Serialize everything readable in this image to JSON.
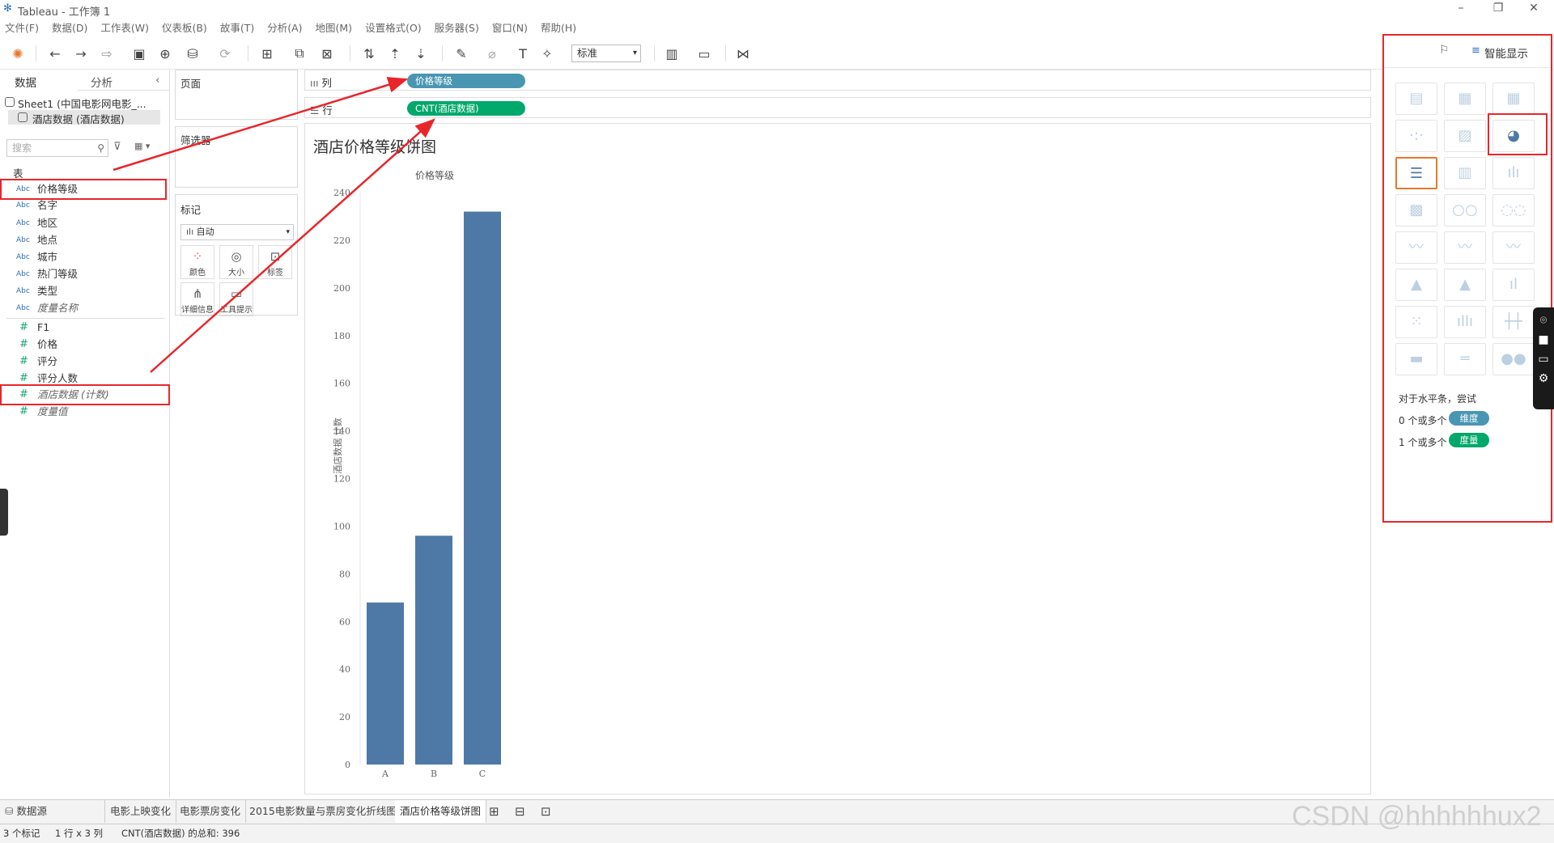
{
  "window": {
    "title": "Tableau - 工作簿 1"
  },
  "menu": [
    "文件(F)",
    "数据(D)",
    "工作表(W)",
    "仪表板(B)",
    "故事(T)",
    "分析(A)",
    "地图(M)",
    "设置格式(O)",
    "服务器(S)",
    "窗口(N)",
    "帮助(H)"
  ],
  "toolbar": {
    "fit_select": "标准"
  },
  "data_panel": {
    "tab_data": "数据",
    "tab_analysis": "分析",
    "sources": [
      "Sheet1 (中国电影网电影_...",
      "酒店数据 (酒店数据)"
    ],
    "search_placeholder": "搜索",
    "section_label": "表",
    "dimensions": [
      {
        "type": "Abc",
        "name": "价格等级"
      },
      {
        "type": "Abc",
        "name": "名字"
      },
      {
        "type": "Abc",
        "name": "地区"
      },
      {
        "type": "Abc",
        "name": "地点"
      },
      {
        "type": "Abc",
        "name": "城市"
      },
      {
        "type": "Abc",
        "name": "热门等级"
      },
      {
        "type": "Abc",
        "name": "类型"
      },
      {
        "type": "Abc",
        "name": "度量名称"
      }
    ],
    "measures": [
      {
        "type": "#",
        "name": "F1"
      },
      {
        "type": "#",
        "name": "价格"
      },
      {
        "type": "#",
        "name": "评分"
      },
      {
        "type": "#",
        "name": "评分人数"
      },
      {
        "type": "#",
        "name": "酒店数据 (计数)"
      },
      {
        "type": "#",
        "name": "度量值"
      }
    ]
  },
  "cards": {
    "pages": "页面",
    "filters": "筛选器",
    "marks": "标记",
    "mark_type": "自动",
    "mark_buttons": [
      "颜色",
      "大小",
      "标签",
      "详细信息",
      "工具提示"
    ]
  },
  "shelves": {
    "columns_label": "列",
    "rows_label": "行",
    "columns_pill": "价格等级",
    "rows_pill": "CNT(酒店数据)"
  },
  "view": {
    "title": "酒店价格等级饼图",
    "x_header": "价格等级",
    "y_label": "酒店数据 计数"
  },
  "chart_data": {
    "type": "bar",
    "categories": [
      "A",
      "B",
      "C"
    ],
    "values": [
      68,
      96,
      232
    ],
    "ylabel": "酒店数据 计数",
    "ylim": [
      0,
      240
    ],
    "yticks": [
      0,
      20,
      40,
      60,
      80,
      100,
      120,
      140,
      160,
      180,
      200,
      220,
      240
    ],
    "bar_color": "#4e79a7"
  },
  "show_me": {
    "title": "智能显示",
    "hint": "对于水平条，尝试",
    "req1_prefix": "0 个或多个",
    "req1_pill": "维度",
    "req2_prefix": "1 个或多个",
    "req2_pill": "度量"
  },
  "sheet_tabs": [
    "数据源",
    "电影上映变化",
    "电影票房变化",
    "2015电影数量与票房变化折线图",
    "酒店价格等级饼图"
  ],
  "status": {
    "marks": "3 个标记",
    "dims": "1 行 x 3 列",
    "sum": "CNT(酒店数据) 的总和: 396"
  },
  "watermark": "CSDN @hhhhhhux2",
  "colors": {
    "dimension_pill": "#4996b2",
    "measure_pill": "#00a86b",
    "highlight": "#e8262a"
  }
}
